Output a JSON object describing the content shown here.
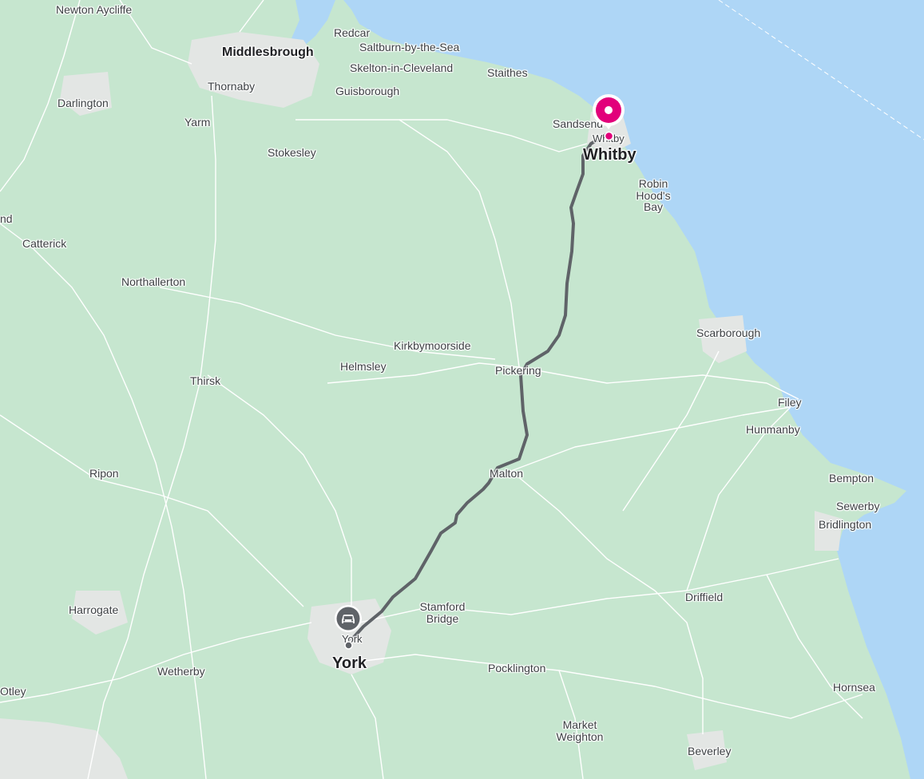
{
  "map": {
    "origin": {
      "name": "York",
      "icon": "car-icon"
    },
    "destination": {
      "name": "Whitby",
      "icon": "destination-pin-icon",
      "color": "#e2007a"
    },
    "route_color": "#5f6368",
    "land_color": "#c6e6cf",
    "sea_color": "#aed6f6",
    "places": [
      "Newton Aycliffe",
      "Middlesbrough",
      "Redcar",
      "Saltburn-by-the-Sea",
      "Skelton-in-Cleveland",
      "Staithes",
      "Thornaby",
      "Darlington",
      "Guisborough",
      "Yarm",
      "Stokesley",
      "Sandsend",
      "Whitby",
      "Robin Hood's Bay",
      "nd",
      "Catterick",
      "Northallerton",
      "Scarborough",
      "Kirkbymoorside",
      "Helmsley",
      "Pickering",
      "Thirsk",
      "Filey",
      "Hunmanby",
      "Ripon",
      "Malton",
      "Bempton",
      "Sewerby",
      "Bridlington",
      "Harrogate",
      "Stamford Bridge",
      "Driffield",
      "York",
      "Wetherby",
      "Pocklington",
      "Otley",
      "Hornsea",
      "Market Weighton",
      "Beverley"
    ]
  }
}
